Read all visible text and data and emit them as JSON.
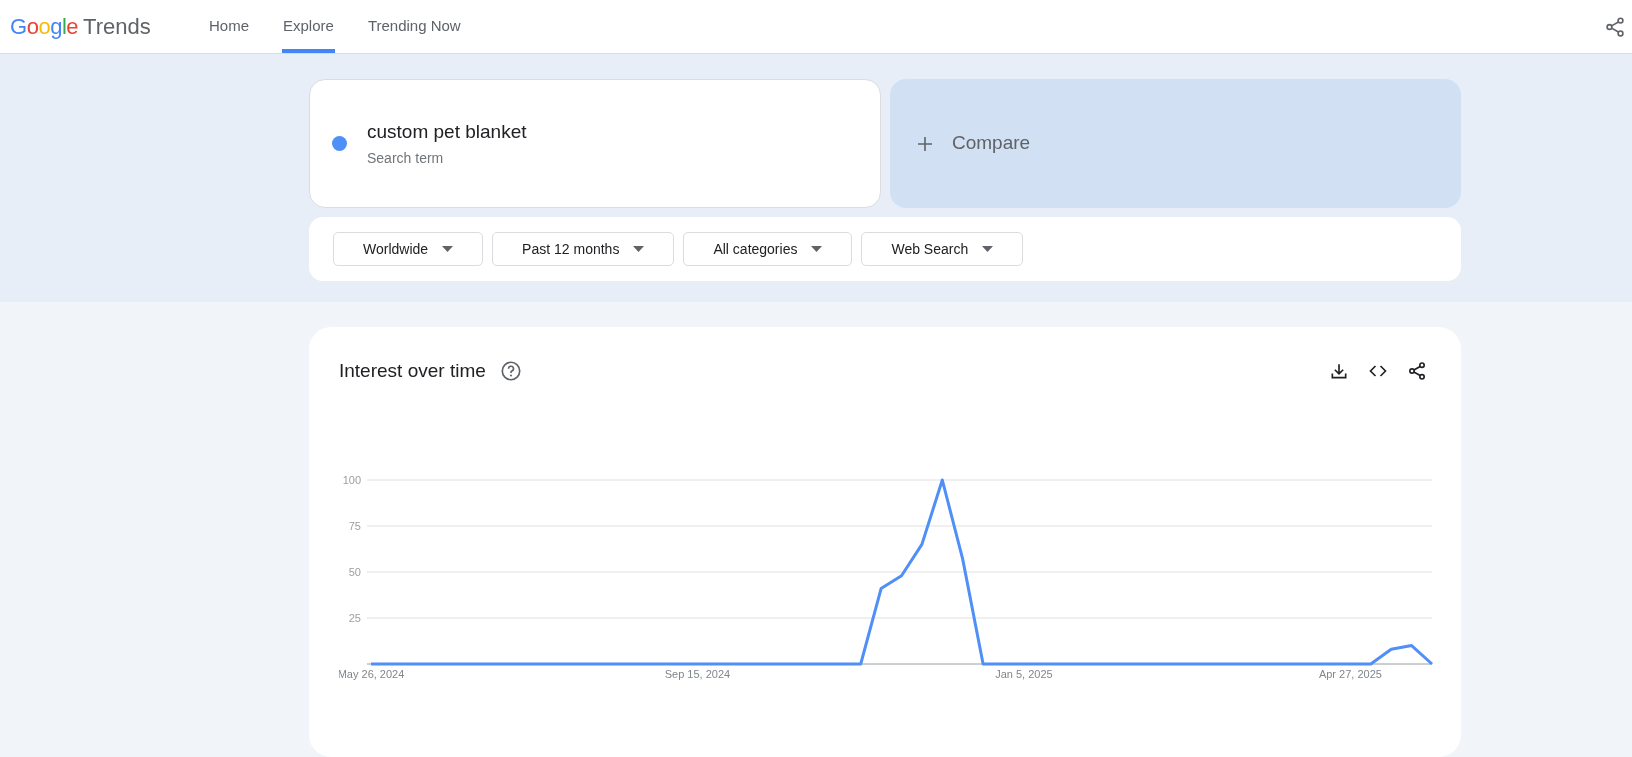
{
  "header": {
    "logo_brand": "Google",
    "logo_product": "Trends",
    "nav": [
      {
        "label": "Home",
        "selected": false
      },
      {
        "label": "Explore",
        "selected": true
      },
      {
        "label": "Trending Now",
        "selected": false
      }
    ]
  },
  "search": {
    "term": "custom pet blanket",
    "color": "#4f8ff7",
    "subtitle": "Search term",
    "compare": "Compare"
  },
  "filters": [
    "Worldwide",
    "Past 12 months",
    "All categories",
    "Web Search"
  ],
  "interest_over_time": {
    "title": "Interest over time",
    "chart_data": {
      "type": "line",
      "ylim": [
        0,
        100
      ],
      "yticks": [
        25,
        50,
        75,
        100
      ],
      "grid": true,
      "categories": [
        "May 26, 2024",
        null,
        null,
        null,
        null,
        null,
        null,
        null,
        null,
        null,
        null,
        null,
        null,
        null,
        null,
        null,
        "Sep 15, 2024",
        null,
        null,
        null,
        null,
        null,
        null,
        null,
        null,
        null,
        null,
        null,
        null,
        null,
        null,
        null,
        "Jan 5, 2025",
        null,
        null,
        null,
        null,
        null,
        null,
        null,
        null,
        null,
        null,
        null,
        null,
        null,
        null,
        null,
        "Apr 27, 2025",
        null,
        null,
        null,
        null
      ],
      "series": [
        {
          "color": "#4f8ff7",
          "values": [
            0,
            0,
            0,
            0,
            0,
            0,
            0,
            0,
            0,
            0,
            0,
            0,
            0,
            0,
            0,
            0,
            0,
            0,
            0,
            0,
            0,
            0,
            0,
            0,
            0,
            41,
            48,
            65,
            100,
            57,
            0,
            0,
            0,
            0,
            0,
            0,
            0,
            0,
            0,
            0,
            0,
            0,
            0,
            0,
            0,
            0,
            0,
            0,
            0,
            0,
            8,
            10,
            0
          ]
        }
      ]
    }
  }
}
